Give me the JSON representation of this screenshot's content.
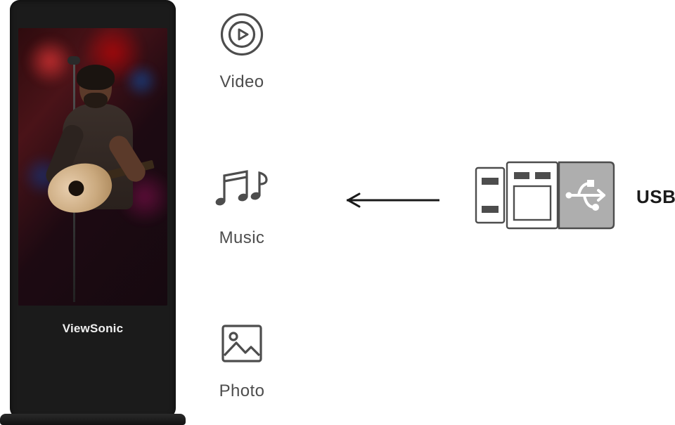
{
  "kiosk": {
    "brand": "ViewSonic"
  },
  "media": {
    "video": "Video",
    "music": "Music",
    "photo": "Photo"
  },
  "source": {
    "usb": "USB"
  },
  "icons": {
    "video": "play-circle-icon",
    "music": "music-notes-icon",
    "photo": "image-icon",
    "arrow": "arrow-left-icon",
    "usb": "usb-drive-icon"
  }
}
